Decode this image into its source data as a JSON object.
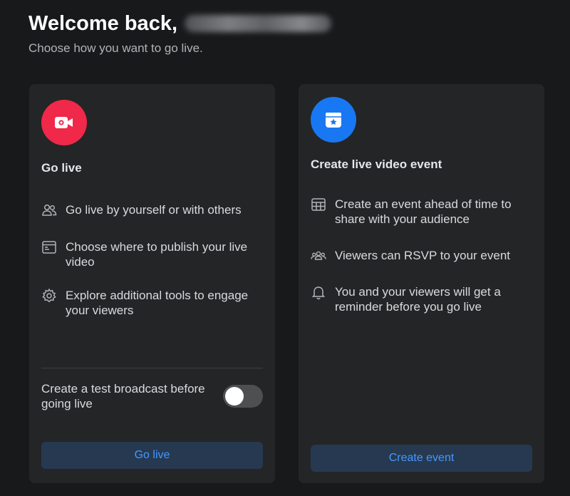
{
  "header": {
    "welcome": "Welcome back,",
    "subtitle": "Choose how you want to go live."
  },
  "go_live_card": {
    "title": "Go live",
    "features": [
      {
        "icon": "people-icon",
        "text": "Go live by yourself or with others"
      },
      {
        "icon": "publish-window-icon",
        "text": "Choose where to publish your live video"
      },
      {
        "icon": "gear-icon",
        "text": "Explore additional tools to engage your viewers"
      }
    ],
    "test_broadcast_label": "Create a test broadcast before going live",
    "test_broadcast_enabled": false,
    "button_label": "Go live"
  },
  "event_card": {
    "title": "Create live video event",
    "features": [
      {
        "icon": "calendar-grid-icon",
        "text": "Create an event ahead of time to share with your audience"
      },
      {
        "icon": "group-icon",
        "text": "Viewers can RSVP to your event"
      },
      {
        "icon": "bell-icon",
        "text": "You and your viewers will get a reminder before you go live"
      }
    ],
    "button_label": "Create event"
  },
  "colors": {
    "background": "#18191a",
    "card": "#242526",
    "live_red": "#f02849",
    "event_blue": "#1877f2",
    "button_bg": "#263951",
    "button_text": "#4599ff"
  }
}
